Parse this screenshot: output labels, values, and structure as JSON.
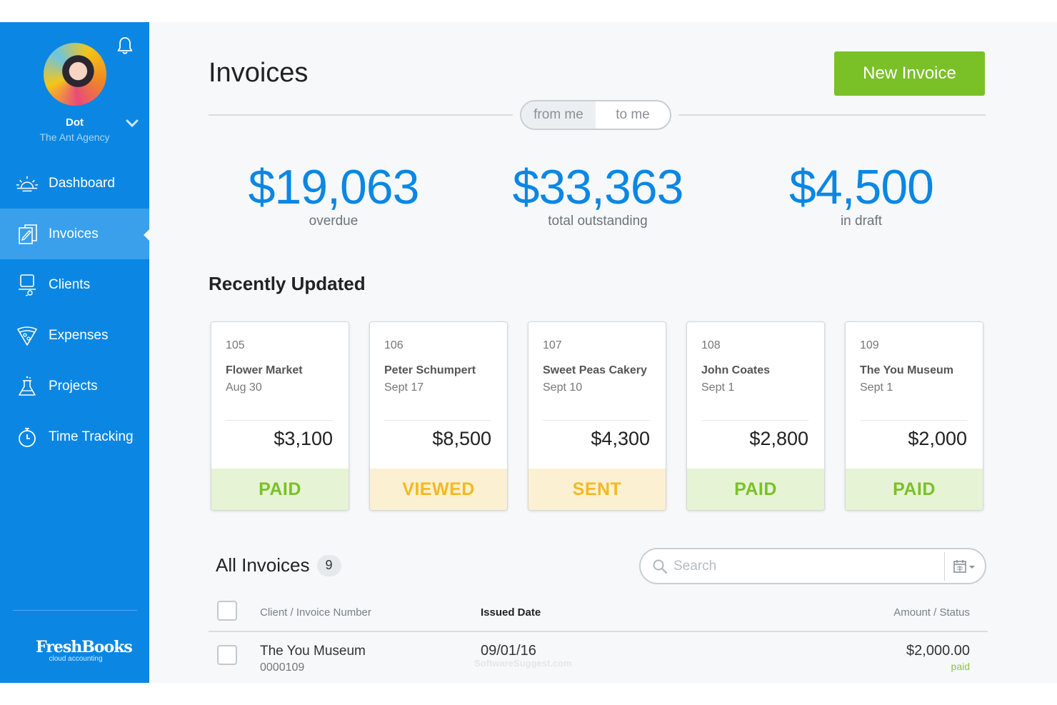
{
  "sidebar": {
    "user_name": "Dot",
    "user_org": "The Ant Agency",
    "items": [
      {
        "label": "Dashboard",
        "icon": "sun-icon"
      },
      {
        "label": "Invoices",
        "icon": "invoice-icon"
      },
      {
        "label": "Clients",
        "icon": "clients-icon"
      },
      {
        "label": "Expenses",
        "icon": "expenses-icon"
      },
      {
        "label": "Projects",
        "icon": "flask-icon"
      },
      {
        "label": "Time Tracking",
        "icon": "stopwatch-icon"
      }
    ],
    "logo_main": "FreshBooks",
    "logo_sub": "cloud accounting"
  },
  "header": {
    "title": "Invoices",
    "new_button": "New Invoice",
    "toggle": [
      "from me",
      "to me"
    ]
  },
  "stats": [
    {
      "value": "$19,063",
      "label": "overdue"
    },
    {
      "value": "$33,363",
      "label": "total outstanding"
    },
    {
      "value": "$4,500",
      "label": "in draft"
    }
  ],
  "recent": {
    "title": "Recently Updated",
    "cards": [
      {
        "number": "105",
        "client": "Flower Market",
        "date": "Aug 30",
        "amount": "$3,100",
        "status": "PAID"
      },
      {
        "number": "106",
        "client": "Peter Schumpert",
        "date": "Sept 17",
        "amount": "$8,500",
        "status": "VIEWED"
      },
      {
        "number": "107",
        "client": "Sweet Peas Cakery",
        "date": "Sept 10",
        "amount": "$4,300",
        "status": "SENT"
      },
      {
        "number": "108",
        "client": "John Coates",
        "date": "Sept 1",
        "amount": "$2,800",
        "status": "PAID"
      },
      {
        "number": "109",
        "client": "The You Museum",
        "date": "Sept 1",
        "amount": "$2,000",
        "status": "PAID"
      }
    ]
  },
  "all_invoices": {
    "title": "All Invoices",
    "count": "9",
    "search_placeholder": "Search",
    "columns": {
      "client": "Client / Invoice Number",
      "date": "Issued Date",
      "amount": "Amount / Status"
    },
    "rows": [
      {
        "client": "The You Museum",
        "number": "0000109",
        "date": "09/01/16",
        "amount": "$2,000.00",
        "status": "paid"
      }
    ]
  },
  "watermark": "SoftwareSuggest.com",
  "colors": {
    "sidebar": "#0b87e3",
    "accent_blue": "#0b87e3",
    "green_button": "#7ac127",
    "paid_bg": "#e6f4d5",
    "paid_fg": "#7ac127",
    "pending_bg": "#fbf0d2",
    "pending_fg": "#f5b920"
  }
}
